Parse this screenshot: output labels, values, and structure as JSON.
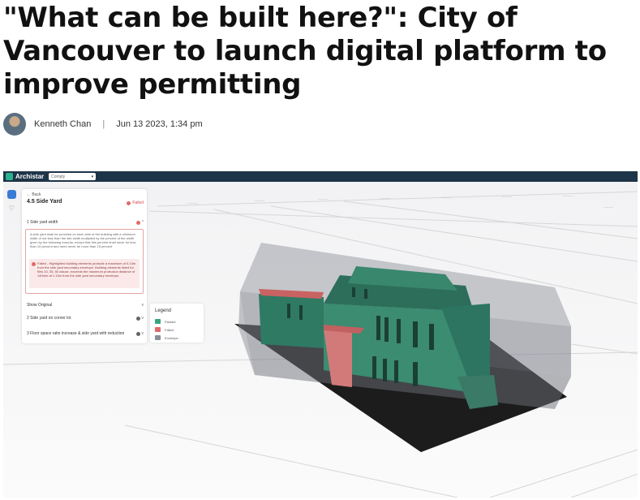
{
  "article": {
    "title": "\"What can be built here?\": City of Vancouver to launch digital platform to improve permitting",
    "author": "Kenneth Chan",
    "separator": "|",
    "date": "Jun 13 2023, 1:34 pm"
  },
  "app": {
    "name": "Archistar",
    "mode_select": "Comply",
    "panel": {
      "back_label": "Back",
      "title": "4.5 Side Yard",
      "status": "Failed",
      "section1_label": "1 Side yard width",
      "section1_description": "A side yard shall be provided on each side of the building with a minimum width of not less than the site width multiplied by the percent of the width given by the following formula, except that this percent shall never be less than 10 percent and need never be more than 15 percent",
      "fail_message": "Failed - Highlighted building elements protrude a maximum of 0.13m from the side yard secondary envelope. Building elements listed for files 10, 35, 50 clause, exceeds the maximum protrusion distance of 140mm at 1.13m from the side yard secondary envelope.",
      "show_original_label": "Show Original",
      "section2_label": "2 Side yard on corner lot",
      "section3_label": "3 Floor space ratio increase & side yard with reduction"
    },
    "legend": {
      "title": "Legend",
      "items": [
        {
          "label": "Passed",
          "color": "#3aa57a"
        },
        {
          "label": "Failed",
          "color": "#e06a6a"
        },
        {
          "label": "Envelope",
          "color": "#8a8e96"
        }
      ]
    },
    "colors": {
      "topbar": "#1e3448",
      "accent": "#3a7bd5",
      "passed": "#3aa57a",
      "failed": "#e06a6a",
      "envelope": "#8a8e96"
    }
  }
}
